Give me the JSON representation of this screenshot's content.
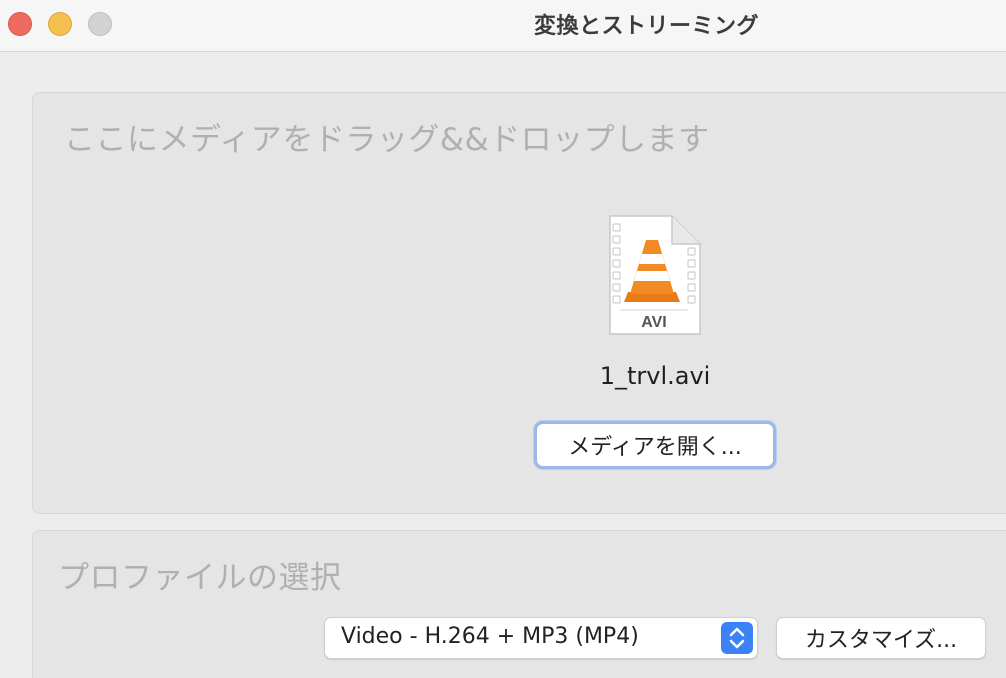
{
  "window": {
    "title": "変換とストリーミング"
  },
  "drop_zone": {
    "heading": "ここにメディアをドラッグ&&ドロップします",
    "file_name": "1_trvl.avi",
    "file_icon": "avi-file-icon",
    "file_icon_label": "AVI",
    "open_button_label": "メディアを開く..."
  },
  "profile": {
    "heading": "プロファイルの選択",
    "selected_profile": "Video - H.264 + MP3 (MP4)",
    "customize_label": "カスタマイズ..."
  },
  "colors": {
    "close": "#ed6a5e",
    "minimize": "#f5bf4f",
    "zoom": "#d3d3d3",
    "accent": "#3b82f6",
    "cone_orange": "#f08a24"
  }
}
